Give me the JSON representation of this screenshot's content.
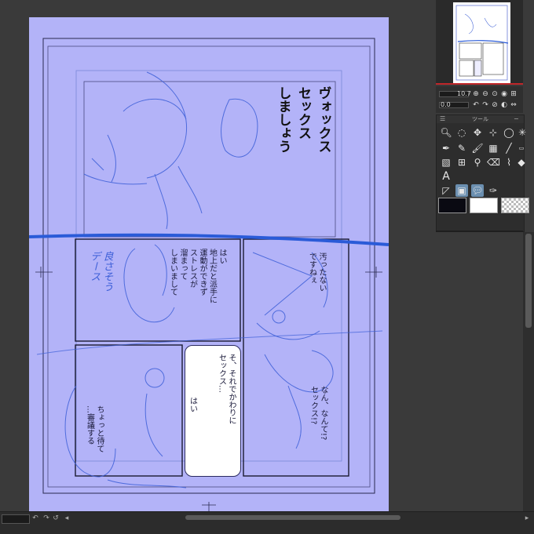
{
  "manga": {
    "panel1_text": "ヴォックス\nセックス\nしましょう",
    "panel2_text": "はい\n地上だと派手に\n運動ができず\nストレスが\n溜まって\nしまいまして",
    "panel3_text_top": "汚ったない\nですねぇ",
    "panel3_text_bottom": "なん、なんて!?\nセックス!?",
    "panel4_text": "ちょっと待て\n…審議する",
    "panel5_text_main": "そ、それでかわりに\nセックス…",
    "panel5_text_side": "はい",
    "sketch_scribble": "良さそう\nデース"
  },
  "navctl": {
    "zoom_value": "10.7",
    "angle_value": "0.0"
  },
  "toolpanel": {
    "title": "ツール"
  },
  "colors": {
    "main": "#0a0a12",
    "sub": "#ffffff",
    "page_tint": "#b3b3f8",
    "stroke": "#2a5bd8"
  },
  "icons": [
    "zoom-in-icon",
    "zoom-out-icon",
    "hand-icon",
    "rotate-icon",
    "pen-icon",
    "pencil-icon",
    "brush-icon",
    "eraser-icon",
    "fill-icon",
    "eyedropper-icon",
    "text-icon",
    "lasso-icon",
    "move-icon"
  ]
}
